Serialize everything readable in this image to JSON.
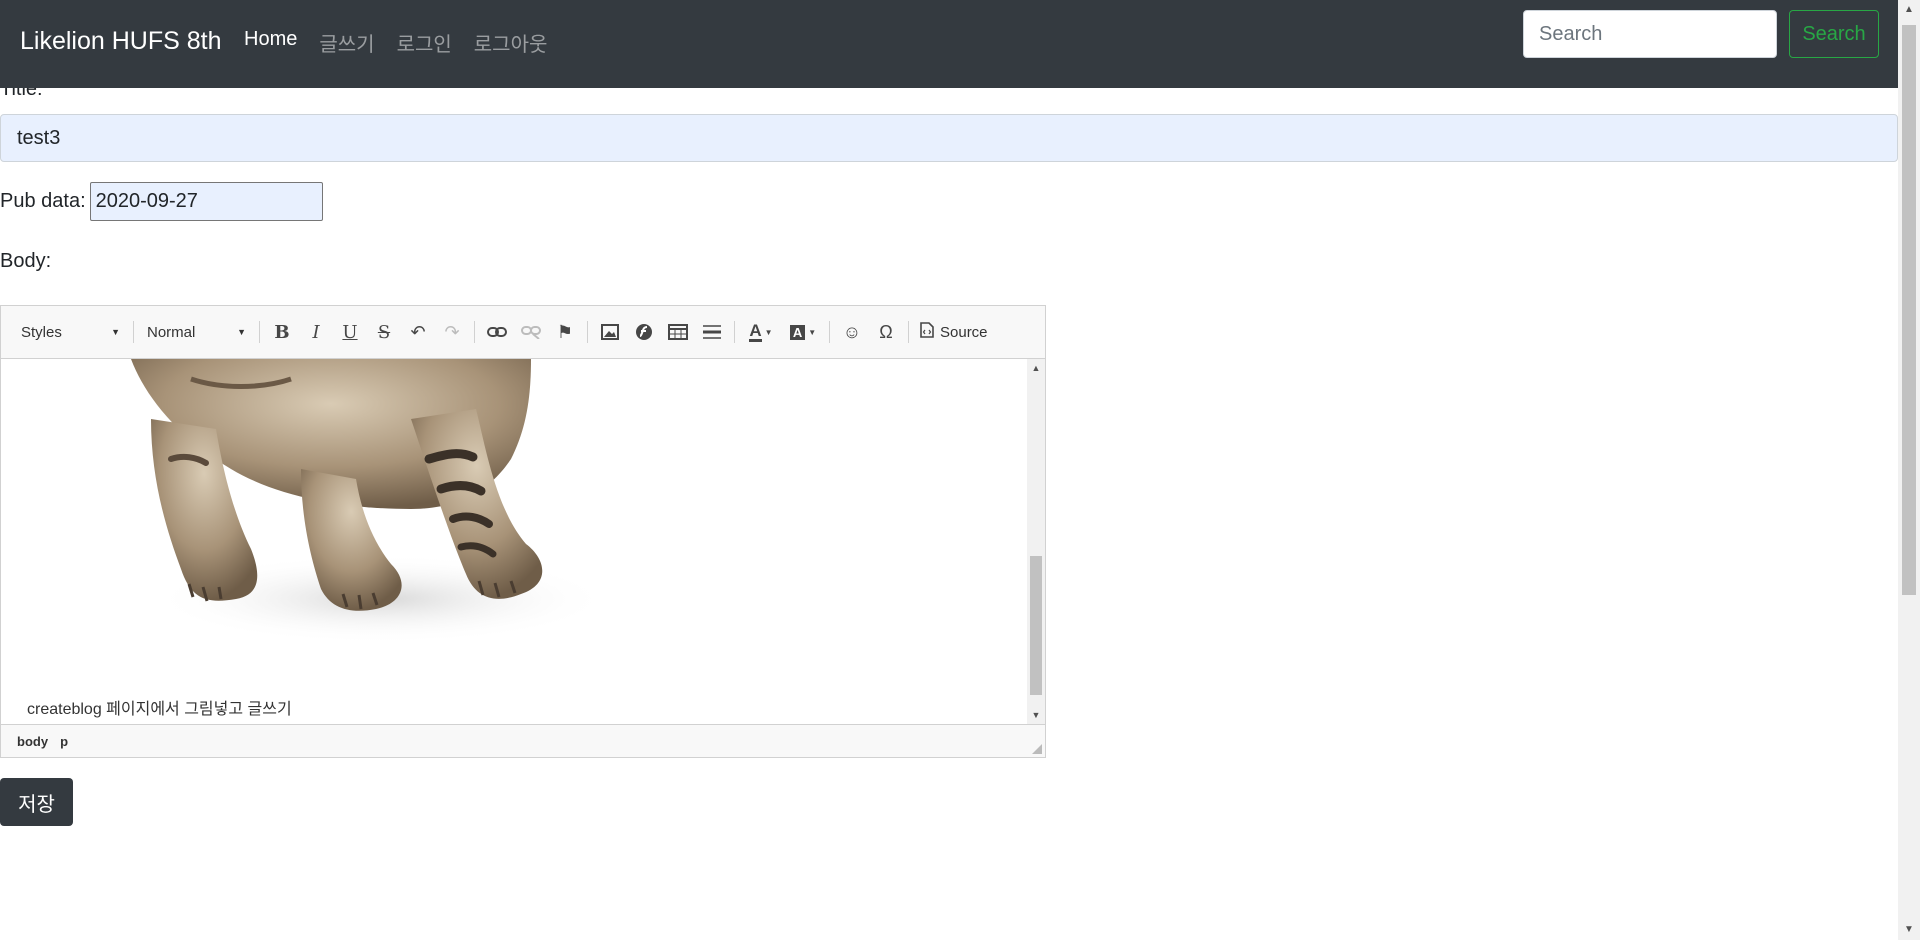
{
  "navbar": {
    "brand": "Likelion HUFS 8th",
    "links": [
      "Home",
      "글쓰기",
      "로그인",
      "로그아웃"
    ],
    "search_placeholder": "Search",
    "search_button": "Search"
  },
  "form": {
    "title_label": "Title:",
    "title_value": "test3",
    "pub_label": "Pub data:",
    "pub_value": "2020-09-27",
    "body_label": "Body:",
    "save_button": "저장"
  },
  "editor": {
    "styles_combo": "Styles",
    "format_combo": "Normal",
    "source_label": "Source",
    "caption": "createblog 페이지에서 그림넣고 글쓰기",
    "path": [
      "body",
      "p"
    ],
    "toolbar_icons": [
      "bold-icon",
      "italic-icon",
      "underline-icon",
      "strikethrough-icon",
      "undo-icon",
      "redo-icon",
      "link-icon",
      "unlink-icon",
      "anchor-icon",
      "image-icon",
      "flash-icon",
      "table-icon",
      "horizontal-line-icon",
      "text-color-icon",
      "background-color-icon",
      "smiley-icon",
      "special-char-icon",
      "source-icon"
    ]
  },
  "colors": {
    "navbar_bg": "#343a40",
    "autofill_bg": "#e8f0fe",
    "success": "#28a745"
  }
}
